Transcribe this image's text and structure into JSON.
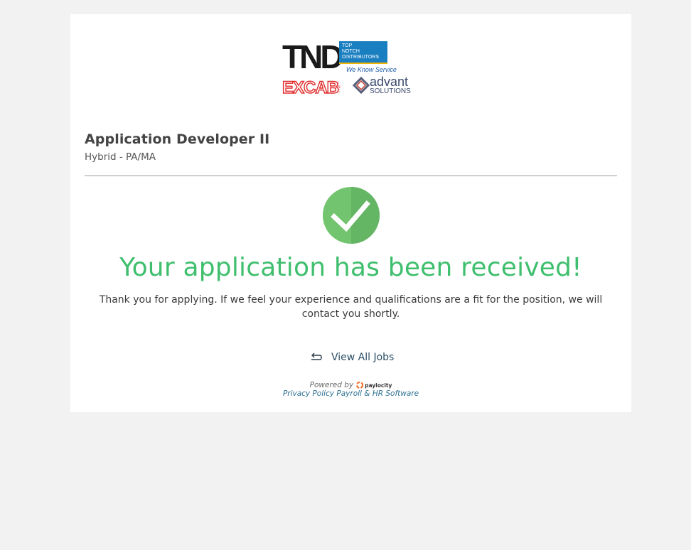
{
  "logo": {
    "tnd_letters": "TND",
    "tnd_tagline_lines": [
      "TOP",
      "NOTCH",
      "DISTRIBUTORS"
    ],
    "tnd_slogan": "We Know Service",
    "excab_text": "EXCAB",
    "excab_suffix": "INC",
    "advant_text": "advant",
    "advant_sub": "SOLUTIONS"
  },
  "job": {
    "title": "Application Developer II",
    "location": "Hybrid - PA/MA"
  },
  "confirmation": {
    "headline": "Your application has been received!",
    "message": "Thank you for applying. If we feel your experience and qualifications are a fit for the position, we will contact you shortly."
  },
  "actions": {
    "view_all_jobs": "View All Jobs"
  },
  "footer": {
    "powered_by": "Powered by",
    "paylocity_brand": "paylocity",
    "privacy_policy": "Privacy Policy",
    "payroll_hr": "Payroll & HR Software"
  },
  "colors": {
    "success_green": "#3fbf6e",
    "check_circle": "#6cc36b",
    "link_blue": "#2a6f91",
    "excab_red": "#e02b2b",
    "tnd_blue": "#1a7fc1"
  }
}
